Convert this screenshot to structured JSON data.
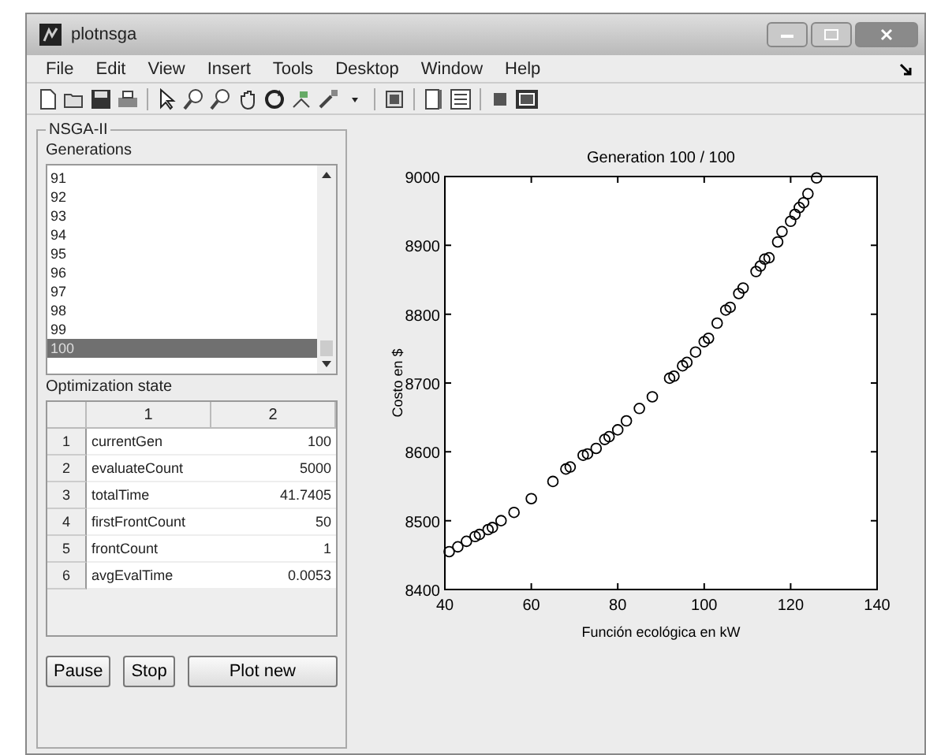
{
  "window": {
    "title": "plotnsga"
  },
  "menu": [
    "File",
    "Edit",
    "View",
    "Insert",
    "Tools",
    "Desktop",
    "Window",
    "Help"
  ],
  "panel": {
    "title": "NSGA-II",
    "generations": {
      "label": "Generations",
      "items": [
        {
          "label": "91",
          "selected": false
        },
        {
          "label": "92",
          "selected": false
        },
        {
          "label": "93",
          "selected": false
        },
        {
          "label": "94",
          "selected": false
        },
        {
          "label": "95",
          "selected": false
        },
        {
          "label": "96",
          "selected": false
        },
        {
          "label": "97",
          "selected": false
        },
        {
          "label": "98",
          "selected": false
        },
        {
          "label": "99",
          "selected": false
        },
        {
          "label": "100",
          "selected": true
        }
      ]
    },
    "state": {
      "label": "Optimization state",
      "columns": [
        "1",
        "2"
      ],
      "rows": [
        {
          "index": "1",
          "name": "currentGen",
          "value": "100"
        },
        {
          "index": "2",
          "name": "evaluateCount",
          "value": "5000"
        },
        {
          "index": "3",
          "name": "totalTime",
          "value": "41.7405"
        },
        {
          "index": "4",
          "name": "firstFrontCount",
          "value": "50"
        },
        {
          "index": "5",
          "name": "frontCount",
          "value": "1"
        },
        {
          "index": "6",
          "name": "avgEvalTime",
          "value": "0.0053"
        }
      ]
    },
    "buttons": [
      "Pause",
      "Stop",
      "Plot new"
    ]
  },
  "plot": {
    "chart_data": {
      "type": "scatter",
      "title": "Generation 100 / 100",
      "xlabel": "Función ecológica en kW",
      "ylabel": "Costo en $",
      "xlim": [
        40,
        140
      ],
      "ylim": [
        8400,
        9000
      ],
      "xticks": [
        40,
        60,
        80,
        100,
        120,
        140
      ],
      "yticks": [
        8400,
        8500,
        8600,
        8700,
        8800,
        8900,
        9000
      ],
      "x": [
        41,
        43,
        45,
        47,
        48,
        50,
        51,
        53,
        56,
        60,
        65,
        68,
        69,
        72,
        73,
        75,
        77,
        78,
        80,
        82,
        85,
        88,
        92,
        93,
        95,
        96,
        98,
        100,
        101,
        103,
        105,
        106,
        108,
        109,
        112,
        113,
        114,
        115,
        117,
        118,
        120,
        121,
        122,
        123,
        124,
        126
      ],
      "series": [
        {
          "color": "#000000",
          "values": [
            8455,
            8462,
            8470,
            8477,
            8480,
            8487,
            8490,
            8500,
            8512,
            8532,
            8557,
            8575,
            8578,
            8595,
            8597,
            8605,
            8618,
            8622,
            8632,
            8645,
            8663,
            8680,
            8707,
            8710,
            8725,
            8730,
            8745,
            8760,
            8765,
            8787,
            8806,
            8810,
            8830,
            8838,
            8862,
            8870,
            8880,
            8882,
            8905,
            8920,
            8935,
            8945,
            8955,
            8962,
            8975,
            8998
          ]
        }
      ]
    }
  }
}
